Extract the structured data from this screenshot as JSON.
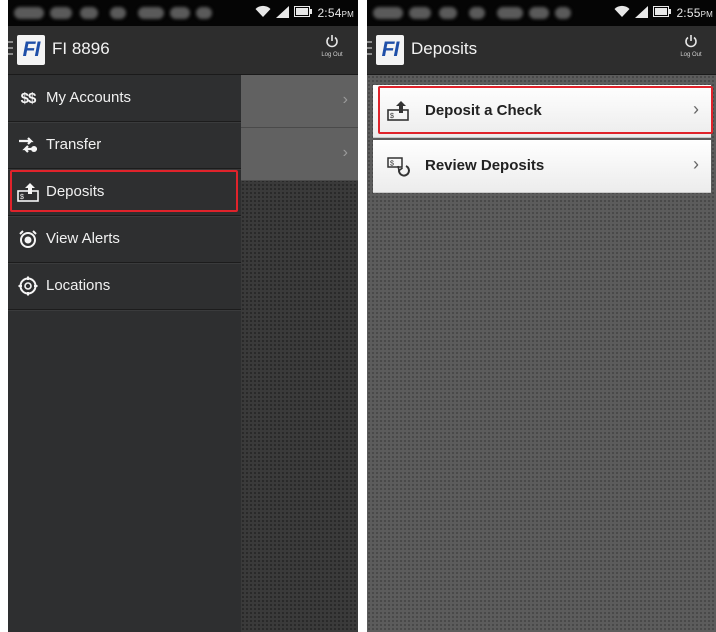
{
  "left_screen": {
    "status_time": "2:54",
    "status_ampm": "PM",
    "app_logo": "FI",
    "app_title": "FI 8896",
    "logout_label": "Log Out",
    "drawer_items": [
      {
        "label": "My Accounts",
        "icon": "dollar-icon"
      },
      {
        "label": "Transfer",
        "icon": "transfer-icon"
      },
      {
        "label": "Deposits",
        "icon": "deposit-icon",
        "highlighted": true
      },
      {
        "label": "View Alerts",
        "icon": "alarm-icon"
      },
      {
        "label": "Locations",
        "icon": "location-icon"
      }
    ]
  },
  "right_screen": {
    "status_time": "2:55",
    "status_ampm": "PM",
    "app_logo": "FI",
    "app_title": "Deposits",
    "logout_label": "Log Out",
    "list_items": [
      {
        "label": "Deposit a Check",
        "icon": "deposit-check-icon",
        "highlighted": true
      },
      {
        "label": "Review Deposits",
        "icon": "review-deposits-icon"
      }
    ]
  },
  "colors": {
    "highlight": "#e0232b",
    "logo_blue": "#1f4fa8",
    "appbar": "#2d2d2d",
    "drawer": "#2e2f30"
  }
}
